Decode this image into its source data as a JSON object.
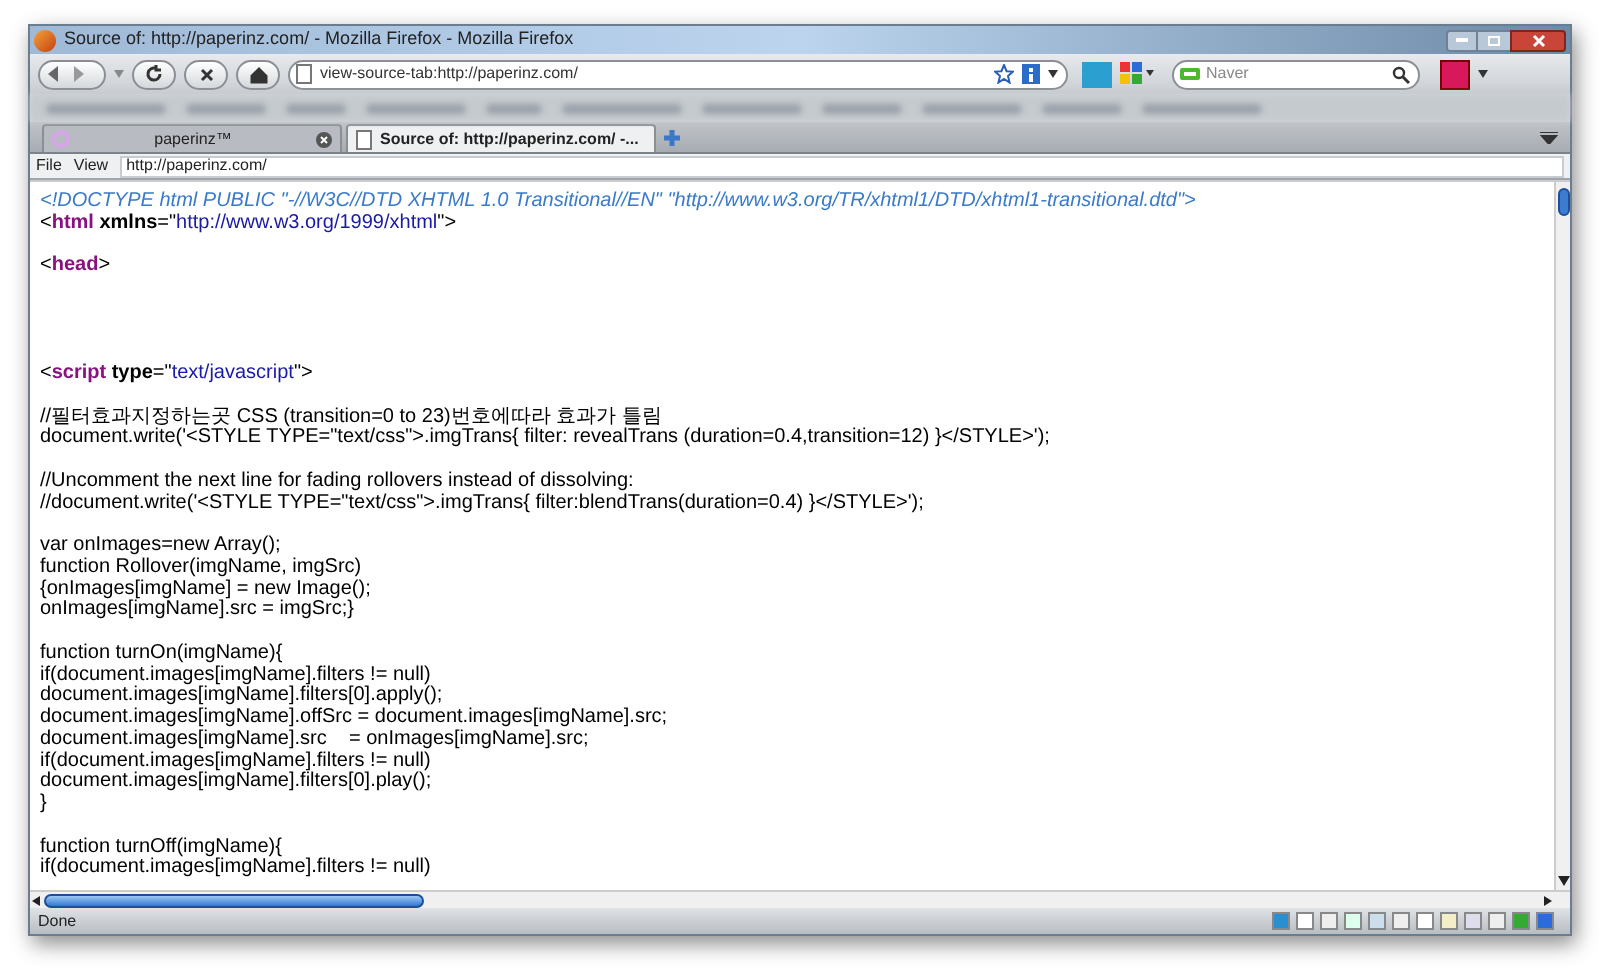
{
  "window": {
    "title": "Source of: http://paperinz.com/ - Mozilla Firefox - Mozilla Firefox"
  },
  "navigation": {
    "address": "view-source-tab:http://paperinz.com/",
    "search_placeholder": "Naver"
  },
  "tabs": [
    {
      "label": "paperinz™",
      "selected": false
    },
    {
      "label": "Source of: http://paperinz.com/ -...",
      "selected": true
    }
  ],
  "menu": [
    "File",
    "View"
  ],
  "source_address": "http://paperinz.com/",
  "source_lines": [
    {
      "kind": "code",
      "segments": [
        {
          "kind": "doctype",
          "text": "<!DOCTYPE html PUBLIC \"-//W3C//DTD XHTML 1.0 Transitional//EN\" \"http://www.w3.org/TR/xhtml1/DTD/xhtml1-transitional.dtd\">"
        }
      ]
    },
    {
      "kind": "code",
      "segments": [
        {
          "kind": "punct",
          "text": "<"
        },
        {
          "kind": "tag",
          "text": "html"
        },
        {
          "kind": "attr",
          "text": " xmlns"
        },
        {
          "kind": "punct",
          "text": "=\""
        },
        {
          "kind": "value",
          "text": "http://www.w3.org/1999/xhtml"
        },
        {
          "kind": "punct",
          "text": "\">"
        }
      ]
    },
    {
      "kind": "blank"
    },
    {
      "kind": "code",
      "segments": [
        {
          "kind": "punct",
          "text": "<"
        },
        {
          "kind": "tag",
          "text": "head"
        },
        {
          "kind": "punct",
          "text": ">"
        }
      ]
    },
    {
      "kind": "blank"
    },
    {
      "kind": "blank"
    },
    {
      "kind": "blank"
    },
    {
      "kind": "blank"
    },
    {
      "kind": "code",
      "segments": [
        {
          "kind": "punct",
          "text": "<"
        },
        {
          "kind": "tag",
          "text": "script"
        },
        {
          "kind": "attr",
          "text": " type"
        },
        {
          "kind": "punct",
          "text": "=\""
        },
        {
          "kind": "value",
          "text": "text/javascript"
        },
        {
          "kind": "punct",
          "text": "\">"
        }
      ]
    },
    {
      "kind": "blank"
    },
    {
      "kind": "code",
      "segments": [
        {
          "kind": "text",
          "text": "//필터효과지정하는곳 CSS (transition=0 to 23)번호에따라 효과가 틀림"
        }
      ]
    },
    {
      "kind": "code",
      "segments": [
        {
          "kind": "text",
          "text": "document.write('<STYLE TYPE=\"text/css\">.imgTrans{ filter: revealTrans (duration=0.4,transition=12) }</STYLE>');"
        }
      ]
    },
    {
      "kind": "blank"
    },
    {
      "kind": "code",
      "segments": [
        {
          "kind": "text",
          "text": "//Uncomment the next line for fading rollovers instead of dissolving:"
        }
      ]
    },
    {
      "kind": "code",
      "segments": [
        {
          "kind": "text",
          "text": "//document.write('<STYLE TYPE=\"text/css\">.imgTrans{ filter:blendTrans(duration=0.4) }</STYLE>');"
        }
      ]
    },
    {
      "kind": "blank"
    },
    {
      "kind": "code",
      "segments": [
        {
          "kind": "text",
          "text": "var onImages=new Array();"
        }
      ]
    },
    {
      "kind": "code",
      "segments": [
        {
          "kind": "text",
          "text": "function Rollover(imgName, imgSrc)"
        }
      ]
    },
    {
      "kind": "code",
      "segments": [
        {
          "kind": "text",
          "text": "{onImages[imgName] = new Image();"
        }
      ]
    },
    {
      "kind": "code",
      "segments": [
        {
          "kind": "text",
          "text": "onImages[imgName].src = imgSrc;}"
        }
      ]
    },
    {
      "kind": "blank"
    },
    {
      "kind": "code",
      "segments": [
        {
          "kind": "text",
          "text": "function turnOn(imgName){"
        }
      ]
    },
    {
      "kind": "code",
      "segments": [
        {
          "kind": "text",
          "text": "if(document.images[imgName].filters != null)"
        }
      ]
    },
    {
      "kind": "code",
      "segments": [
        {
          "kind": "text",
          "text": "document.images[imgName].filters[0].apply();"
        }
      ]
    },
    {
      "kind": "code",
      "segments": [
        {
          "kind": "text",
          "text": "document.images[imgName].offSrc = document.images[imgName].src;"
        }
      ]
    },
    {
      "kind": "code",
      "segments": [
        {
          "kind": "text",
          "text": "document.images[imgName].src    = onImages[imgName].src;"
        }
      ]
    },
    {
      "kind": "code",
      "segments": [
        {
          "kind": "text",
          "text": "if(document.images[imgName].filters != null)"
        }
      ]
    },
    {
      "kind": "code",
      "segments": [
        {
          "kind": "text",
          "text": "document.images[imgName].filters[0].play();"
        }
      ]
    },
    {
      "kind": "code",
      "segments": [
        {
          "kind": "text",
          "text": "}"
        }
      ]
    },
    {
      "kind": "blank"
    },
    {
      "kind": "code",
      "segments": [
        {
          "kind": "text",
          "text": "function turnOff(imgName){"
        }
      ]
    },
    {
      "kind": "code",
      "segments": [
        {
          "kind": "text",
          "text": "if(document.images[imgName].filters != null)"
        }
      ]
    }
  ],
  "status_bar": {
    "text": "Done"
  }
}
